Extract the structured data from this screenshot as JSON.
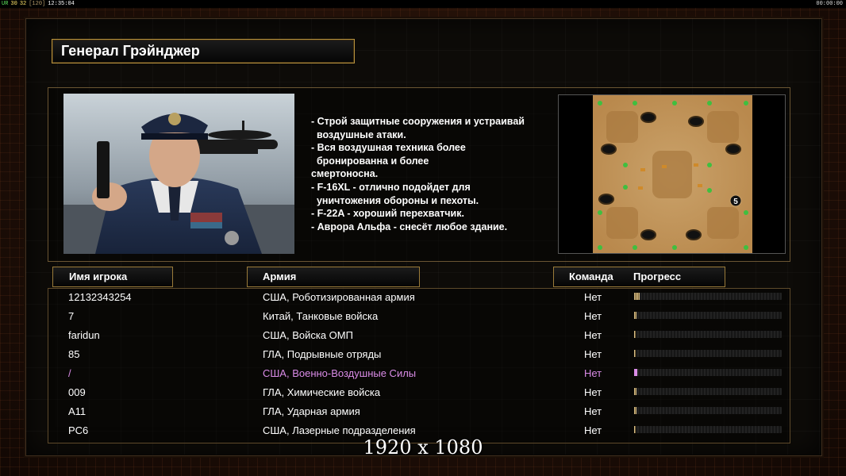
{
  "hud": {
    "ur": "UR",
    "stat_a": "30",
    "stat_b": "32",
    "stat_c": "[120]",
    "clock": "12:35:04",
    "timer": "00:00:00"
  },
  "general": {
    "title": "Генерал Грэйнджер",
    "description_lines": [
      "- Строй защитные сооружения и устраивай",
      "  воздушные атаки.",
      "- Вся воздушная техника более",
      "  бронированна и более",
      "смертоносна.",
      "- F-16XL - отлично подойдет для",
      "  уничтожения обороны и пехоты.",
      "- F-22A - хороший перехватчик.",
      "- Аврора Альфа - снесёт любое здание."
    ]
  },
  "minimap": {
    "player_count_badge": "5"
  },
  "table": {
    "headers": {
      "name": "Имя игрока",
      "army": "Армия",
      "team": "Команда",
      "progress": "Прогресс"
    },
    "rows": [
      {
        "name": "12132343254",
        "army": "США, Роботизированная армия",
        "team": "Нет",
        "progress": 0.04,
        "color": "#ffffff"
      },
      {
        "name": "7",
        "army": "Китай, Танковые войска",
        "team": "Нет",
        "progress": 0.015,
        "color": "#ffffff"
      },
      {
        "name": "faridun",
        "army": "США, Войска ОМП",
        "team": "Нет",
        "progress": 0.01,
        "color": "#ffffff"
      },
      {
        "name": "85",
        "army": "ГЛА, Подрывные отряды",
        "team": "Нет",
        "progress": 0.01,
        "color": "#ffffff"
      },
      {
        "name": "/",
        "army": "США, Военно-Воздушные Силы",
        "team": "Нет",
        "progress": 0.02,
        "color": "#d98be6"
      },
      {
        "name": "009",
        "army": "ГЛА, Химические войска",
        "team": "Нет",
        "progress": 0.015,
        "color": "#ffffff"
      },
      {
        "name": "A11",
        "army": "ГЛА, Ударная армия",
        "team": "Нет",
        "progress": 0.015,
        "color": "#ffffff"
      },
      {
        "name": "PC6",
        "army": "США, Лазерные подразделения",
        "team": "Нет",
        "progress": 0.01,
        "color": "#ffffff"
      }
    ]
  },
  "resolution_label": "1920 x 1080"
}
